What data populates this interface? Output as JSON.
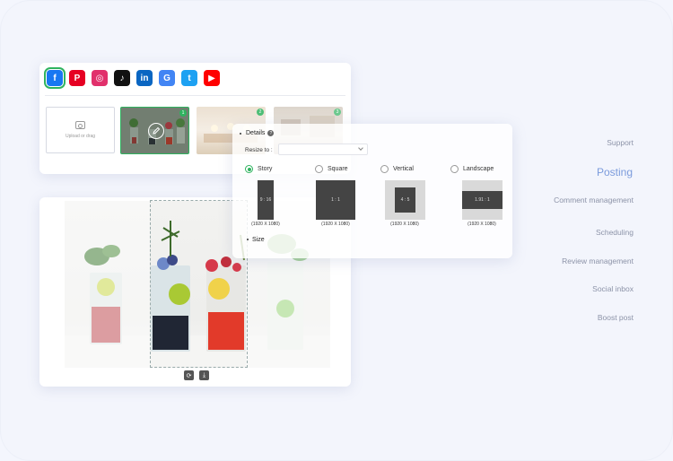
{
  "nav": {
    "items": [
      "Support",
      "Posting",
      "Comment management",
      "Scheduling",
      "Review management",
      "Social inbox",
      "Boost post"
    ],
    "active": "Posting"
  },
  "social": {
    "icons": [
      {
        "name": "facebook-icon",
        "glyph": "f",
        "color": "#1877f2",
        "selected": true
      },
      {
        "name": "pinterest-icon",
        "glyph": "P",
        "color": "#e60023",
        "selected": false
      },
      {
        "name": "instagram-icon",
        "glyph": "◎",
        "color": "#e1306c",
        "selected": false
      },
      {
        "name": "tiktok-icon",
        "glyph": "♪",
        "color": "#111111",
        "selected": false
      },
      {
        "name": "linkedin-icon",
        "glyph": "in",
        "color": "#0a66c2",
        "selected": false
      },
      {
        "name": "google-icon",
        "glyph": "G",
        "color": "#4285f4",
        "selected": false
      },
      {
        "name": "twitter-icon",
        "glyph": "t",
        "color": "#1da1f2",
        "selected": false
      },
      {
        "name": "youtube-icon",
        "glyph": "▶",
        "color": "#ff0000",
        "selected": false
      }
    ]
  },
  "upload": {
    "label": "Upload or drag"
  },
  "thumbs": [
    {
      "badge": "1"
    },
    {
      "badge": "2"
    },
    {
      "badge": "3"
    }
  ],
  "details": {
    "heading": "Details",
    "help": "?",
    "resize_label": "Resize to :",
    "resize_value": "",
    "size_label": "Size",
    "options": [
      {
        "label": "Story",
        "ratio": "9 : 16",
        "dims": "(1920 X 1080)",
        "selected": true
      },
      {
        "label": "Square",
        "ratio": "1 : 1",
        "dims": "(1920 X 1080)",
        "selected": false
      },
      {
        "label": "Vertical",
        "ratio": "4 : 5",
        "dims": "(1920 X 1080)",
        "selected": false
      },
      {
        "label": "Landscape",
        "ratio": "1.91 : 1",
        "dims": "(1920 X 1080)",
        "selected": false
      }
    ]
  },
  "photo_actions": [
    {
      "name": "rotate-icon",
      "glyph": "⟳"
    },
    {
      "name": "download-icon",
      "glyph": "⤓"
    }
  ],
  "colors": {
    "accent": "#2fb35f",
    "nav_active": "#7b9bdc",
    "nav": "#8c93a8"
  }
}
